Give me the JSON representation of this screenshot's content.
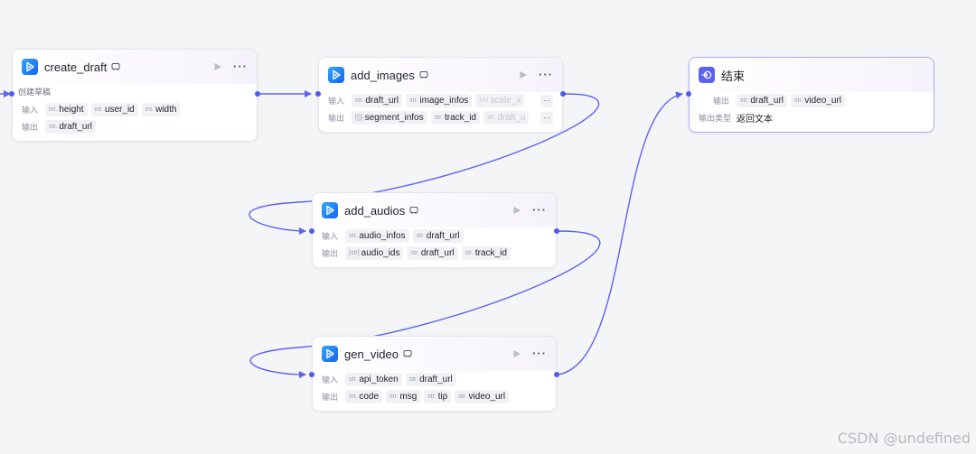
{
  "colors": {
    "edge": "#5b63f0",
    "port": "#4e5ae8",
    "canvas": "#f4f5f7"
  },
  "nodes": {
    "create_draft": {
      "title": "create_draft",
      "icon": "play-app-icon",
      "description": "创建草稿",
      "input_label": "输入",
      "output_label": "输出",
      "inputs": [
        {
          "type": "int.",
          "name": "height"
        },
        {
          "type": "int.",
          "name": "user_id"
        },
        {
          "type": "int.",
          "name": "width"
        }
      ],
      "outputs": [
        {
          "type": "str.",
          "name": "draft_url"
        }
      ]
    },
    "add_images": {
      "title": "add_images",
      "icon": "play-app-icon",
      "input_label": "输入",
      "output_label": "输出",
      "more": "···",
      "inputs": [
        {
          "type": "str.",
          "name": "draft_url"
        },
        {
          "type": "str.",
          "name": "image_infos"
        },
        {
          "type": "NU",
          "name": "scale_x"
        }
      ],
      "outputs": [
        {
          "type": "[{}]",
          "name": "segment_infos"
        },
        {
          "type": "str.",
          "name": "track_id"
        },
        {
          "type": "str.",
          "name": "draft_u"
        }
      ]
    },
    "add_audios": {
      "title": "add_audios",
      "icon": "play-app-icon",
      "input_label": "输入",
      "output_label": "输出",
      "inputs": [
        {
          "type": "str.",
          "name": "audio_infos"
        },
        {
          "type": "str.",
          "name": "draft_url"
        }
      ],
      "outputs": [
        {
          "type": "[str]",
          "name": "audio_ids"
        },
        {
          "type": "str.",
          "name": "draft_url"
        },
        {
          "type": "str.",
          "name": "track_id"
        }
      ]
    },
    "gen_video": {
      "title": "gen_video",
      "icon": "play-app-icon",
      "input_label": "输入",
      "output_label": "输出",
      "inputs": [
        {
          "type": "str.",
          "name": "api_token"
        },
        {
          "type": "str.",
          "name": "draft_url"
        }
      ],
      "outputs": [
        {
          "type": "int.",
          "name": "code"
        },
        {
          "type": "str.",
          "name": "msg"
        },
        {
          "type": "str.",
          "name": "tip"
        },
        {
          "type": "str.",
          "name": "video_url"
        }
      ]
    },
    "end": {
      "title": "结束",
      "icon": "end-exit-icon",
      "output_label": "输出",
      "outputs": [
        {
          "type": "str.",
          "name": "draft_url"
        },
        {
          "type": "str.",
          "name": "video_url"
        }
      ],
      "output_type_label": "输出类型",
      "output_type_value": "返回文本"
    }
  },
  "header_more": "···",
  "watermark": "CSDN @undefined"
}
